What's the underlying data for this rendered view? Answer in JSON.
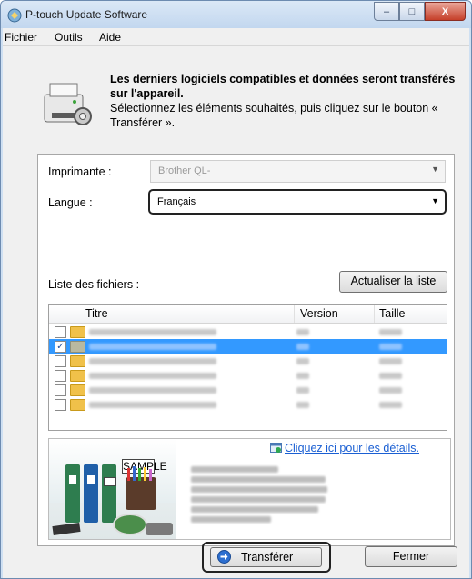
{
  "window": {
    "title": "P-touch Update Software",
    "caption_buttons": {
      "minimize": "–",
      "maximize": "□",
      "close": "X"
    }
  },
  "menu": [
    "Fichier",
    "Outils",
    "Aide"
  ],
  "header": {
    "bold_text": "Les derniers logiciels compatibles et données seront transférés sur l'appareil.",
    "instruction": "Sélectionnez les éléments souhaités, puis cliquez sur le bouton « Transférer »."
  },
  "printer": {
    "label": "Imprimante :",
    "value": "Brother QL-",
    "disabled": true
  },
  "language": {
    "label": "Langue :",
    "value": "Français"
  },
  "file_list": {
    "label": "Liste des fichiers :",
    "refresh_button": "Actualiser la liste",
    "columns": [
      "Titre",
      "Version",
      "Taille"
    ],
    "rows": [
      {
        "checked": false,
        "selected": false,
        "icon": "folder-icon"
      },
      {
        "checked": true,
        "selected": true,
        "icon": "folder-gray-icon"
      },
      {
        "checked": false,
        "selected": false,
        "icon": "folder-icon"
      },
      {
        "checked": false,
        "selected": false,
        "icon": "folder-icon"
      },
      {
        "checked": false,
        "selected": false,
        "icon": "folder-icon"
      },
      {
        "checked": false,
        "selected": false,
        "icon": "folder-icon"
      }
    ]
  },
  "details": {
    "link_text": "Cliquez ici pour les détails.",
    "photo_label": "SAMPLE"
  },
  "buttons": {
    "transfer": "Transférer",
    "close": "Fermer"
  },
  "colors": {
    "selection": "#3399ff",
    "link": "#1a5fd3",
    "title_bar": "#c2d7ef"
  }
}
